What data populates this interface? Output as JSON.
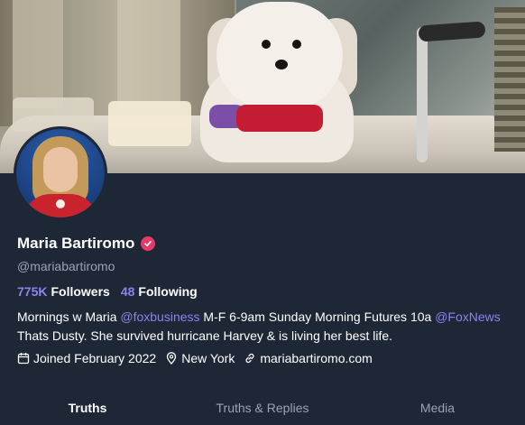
{
  "profile": {
    "name": "Maria Bartiromo",
    "handle": "@mariabartiromo",
    "followers_count": "775K",
    "followers_label": "Followers",
    "following_count": "48",
    "following_label": "Following",
    "bio": {
      "part1": "Mornings w Maria ",
      "mention1": "@foxbusiness",
      "part2": " M-F 6-9am Sunday Morning Futures 10a ",
      "mention2": "@FoxNews",
      "part3": " Thats Dusty. She survived hurricane Harvey & is living her best life."
    },
    "joined": "Joined February 2022",
    "location": "New York",
    "website": "mariabartiromo.com"
  },
  "tabs": [
    {
      "label": "Truths"
    },
    {
      "label": "Truths & Replies"
    },
    {
      "label": "Media"
    }
  ],
  "colors": {
    "background": "#1e2735",
    "accent": "#8a84f0",
    "verified": "#e23b6b"
  },
  "icons": [
    "verified-badge-icon",
    "calendar-icon",
    "location-pin-icon",
    "link-icon"
  ]
}
